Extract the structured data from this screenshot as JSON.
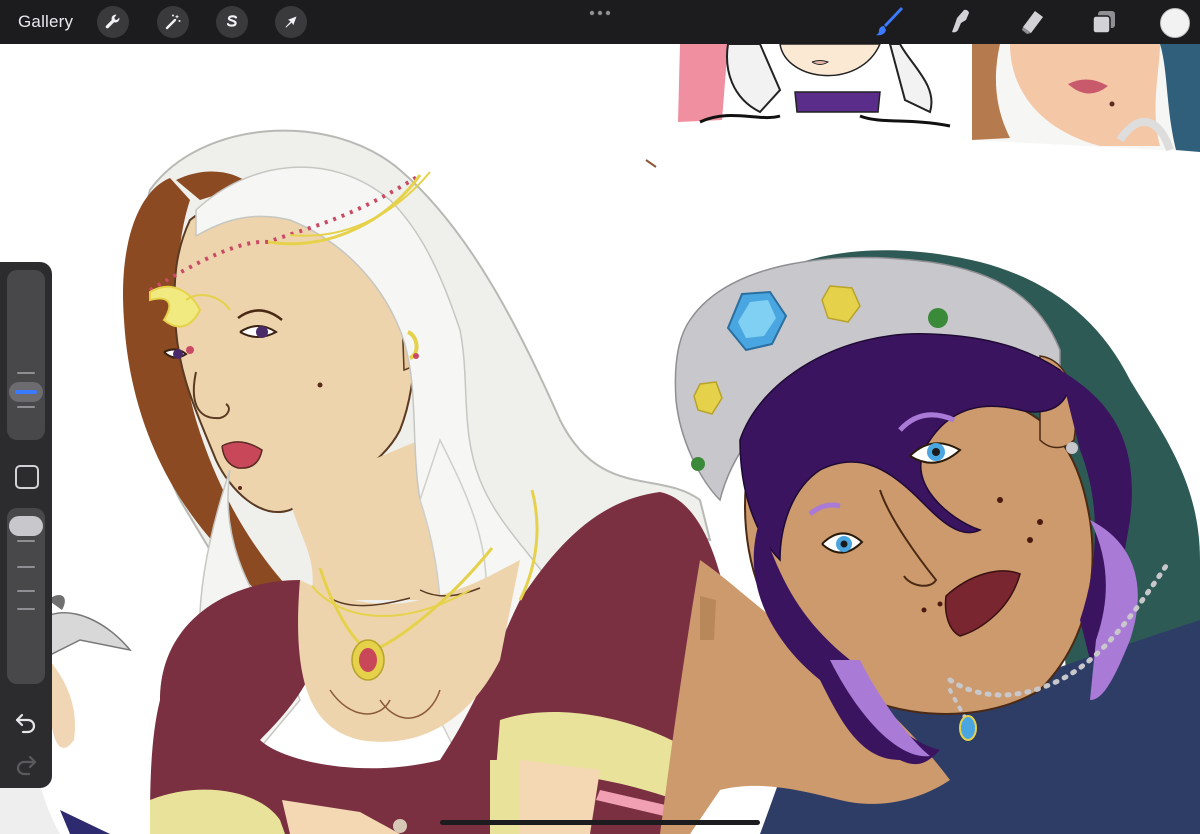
{
  "toolbar": {
    "gallery_label": "Gallery",
    "left_tools": [
      "wrench-icon",
      "magic-wand-icon",
      "selection-s-icon",
      "transform-arrow-icon"
    ],
    "right_tools": [
      "brush-icon",
      "smudge-icon",
      "eraser-icon",
      "layers-icon"
    ],
    "active_tool": "brush",
    "active_tool_color": "#3a7bff",
    "current_color": "#f2f2f2"
  },
  "sidebar": {
    "brush_size_level": 0.62,
    "opacity_level": 0.9,
    "icons": [
      "undo-icon",
      "redo-icon"
    ]
  },
  "canvas": {
    "background": "#ffffff",
    "palette": {
      "skin_light": "#edd4ad",
      "skin_tan": "#cc9a6c",
      "hair_white": "#f4f4f2",
      "hair_brown": "#8b4a22",
      "hair_purple": "#3b1460",
      "hair_lilac": "#a97ad6",
      "dress_maroon": "#7a3040",
      "trim_yellow": "#e8e29a",
      "scarf_grey": "#c8c8cc",
      "scarf_green": "#2e5a55",
      "dress_navy": "#2e3d66",
      "gold": "#e6d24a",
      "gem_red": "#c8485a",
      "gem_blue": "#4aa6e0"
    }
  }
}
